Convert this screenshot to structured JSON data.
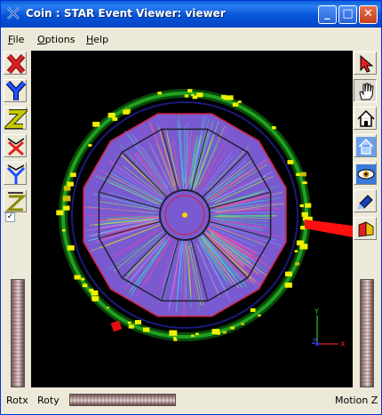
{
  "window": {
    "title": "Coin : STAR Event Viewer: viewer",
    "minimize_glyph": "_",
    "maximize_glyph": "□",
    "close_glyph": "✕"
  },
  "menu": [
    {
      "label": "File",
      "mnemonic": "F",
      "rest": "ile"
    },
    {
      "label": "Options",
      "mnemonic": "O",
      "rest": "ptions"
    },
    {
      "label": "Help",
      "mnemonic": "H",
      "rest": "elp"
    }
  ],
  "left_toolbar": [
    {
      "name": "view-x-axis",
      "icon": "x-axis-icon",
      "label": "X"
    },
    {
      "name": "view-y-axis",
      "icon": "y-axis-icon",
      "label": "Y"
    },
    {
      "name": "view-z-axis",
      "icon": "z-axis-icon",
      "label": "Z"
    },
    {
      "name": "view-x-axis-reverse",
      "icon": "x-axis-reverse-icon",
      "label": "X"
    },
    {
      "name": "view-y-axis-reverse",
      "icon": "y-axis-reverse-icon",
      "label": "Y"
    },
    {
      "name": "view-z-axis-reverse",
      "icon": "z-axis-reverse-icon",
      "label": "Z"
    }
  ],
  "left_checkbox_checked": true,
  "right_toolbar": [
    {
      "name": "select-mode",
      "icon": "arrow-pointer-icon"
    },
    {
      "name": "view-mode",
      "icon": "hand-icon",
      "pressed": true
    },
    {
      "name": "home",
      "icon": "home-icon"
    },
    {
      "name": "set-home",
      "icon": "set-home-icon"
    },
    {
      "name": "view-all",
      "icon": "eye-icon"
    },
    {
      "name": "seek",
      "icon": "flashlight-icon"
    },
    {
      "name": "projection",
      "icon": "perspective-cube-icon"
    }
  ],
  "axis_labels": {
    "x": "X",
    "y": "Y",
    "z": "Z"
  },
  "bottom": {
    "rotx": "Rotx",
    "roty": "Roty",
    "motion_z": "Motion Z"
  },
  "colors": {
    "title_bar": "#0754d8",
    "viewer_bg": "#000000",
    "detector_ring": "#1ea01e",
    "hit_yellow": "#f0f000",
    "track_purple": "#9b70e0",
    "frame_red": "#d0203a",
    "beam_red": "#ff1010",
    "axis_red": "#e02020",
    "axis_blue": "#2030ff",
    "axis_green": "#20c020"
  }
}
